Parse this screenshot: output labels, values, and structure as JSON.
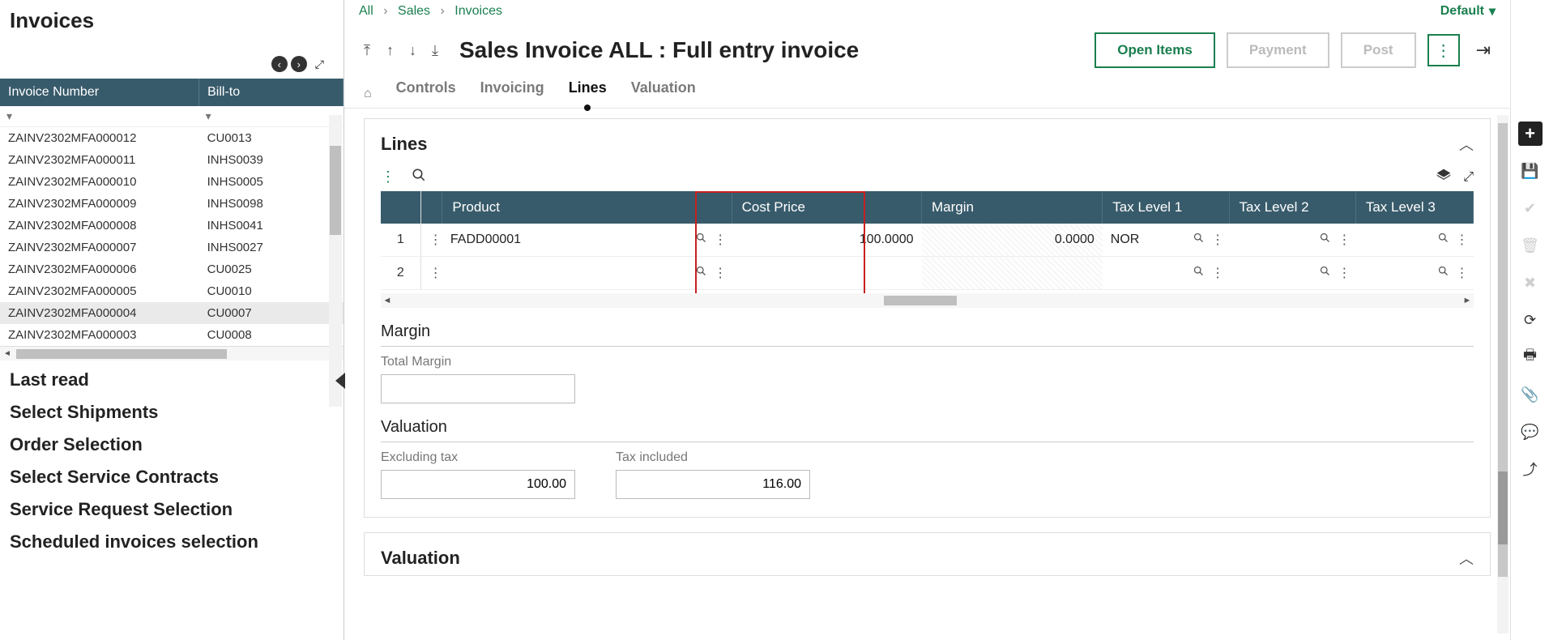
{
  "leftPanel": {
    "title": "Invoices",
    "columns": {
      "col1": "Invoice Number",
      "col2": "Bill-to"
    },
    "rows": [
      {
        "num": "ZAINV2302MFA000012",
        "bill": "CU0013"
      },
      {
        "num": "ZAINV2302MFA000011",
        "bill": "INHS0039"
      },
      {
        "num": "ZAINV2302MFA000010",
        "bill": "INHS0005"
      },
      {
        "num": "ZAINV2302MFA000009",
        "bill": "INHS0098"
      },
      {
        "num": "ZAINV2302MFA000008",
        "bill": "INHS0041"
      },
      {
        "num": "ZAINV2302MFA000007",
        "bill": "INHS0027"
      },
      {
        "num": "ZAINV2302MFA000006",
        "bill": "CU0025"
      },
      {
        "num": "ZAINV2302MFA000005",
        "bill": "CU0010"
      },
      {
        "num": "ZAINV2302MFA000004",
        "bill": "CU0007"
      },
      {
        "num": "ZAINV2302MFA000003",
        "bill": "CU0008"
      }
    ],
    "selectedIndex": 8,
    "links": [
      "Last read",
      "Select Shipments",
      "Order Selection",
      "Select Service Contracts",
      "Service Request Selection",
      "Scheduled invoices selection"
    ]
  },
  "breadcrumb": {
    "a": "All",
    "b": "Sales",
    "c": "Invoices",
    "default": "Default"
  },
  "header": {
    "title": "Sales Invoice ALL : Full entry invoice",
    "openItems": "Open Items",
    "payment": "Payment",
    "post": "Post"
  },
  "tabs": {
    "controls": "Controls",
    "invoicing": "Invoicing",
    "lines": "Lines",
    "valuation": "Valuation"
  },
  "linesSection": {
    "title": "Lines",
    "cols": {
      "product": "Product",
      "cost": "Cost Price",
      "margin": "Margin",
      "tax1": "Tax Level 1",
      "tax2": "Tax Level 2",
      "tax3": "Tax Level 3"
    },
    "rows": [
      {
        "n": "1",
        "product": "FADD00001",
        "cost": "100.0000",
        "margin": "0.0000",
        "tax1": "NOR"
      },
      {
        "n": "2",
        "product": "",
        "cost": "",
        "margin": "",
        "tax1": ""
      }
    ]
  },
  "marginSection": {
    "title": "Margin",
    "totalMarginLabel": "Total Margin",
    "totalMarginValue": ""
  },
  "valuationSection": {
    "title": "Valuation",
    "exclLabel": "Excluding tax",
    "exclValue": "100.00",
    "inclLabel": "Tax included",
    "inclValue": "116.00"
  },
  "valuationPanel": {
    "title": "Valuation"
  }
}
